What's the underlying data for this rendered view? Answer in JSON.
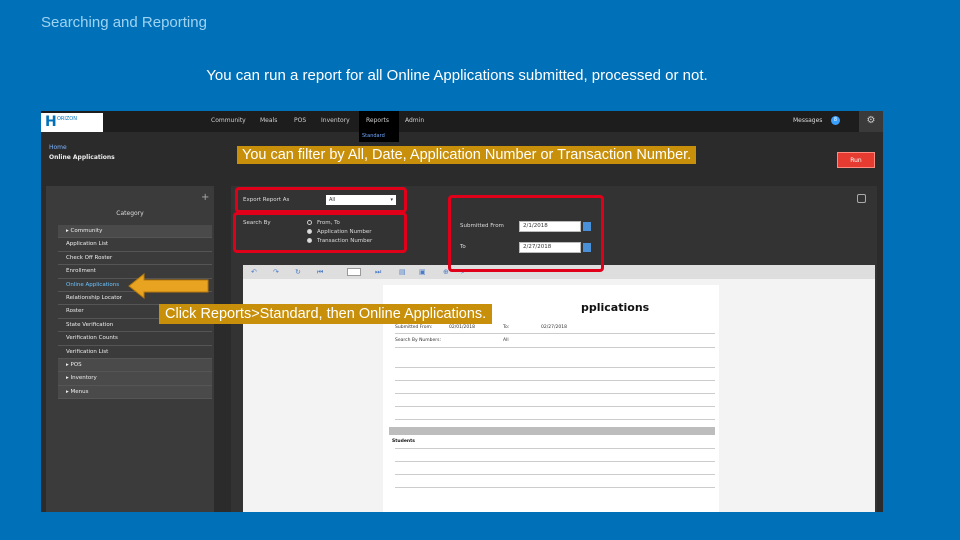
{
  "slide": {
    "title": "Searching and Reporting",
    "subtitle": "You can run a report for all Online Applications submitted, processed or not."
  },
  "callouts": {
    "filter": "You can filter by All, Date, Application Number or Transaction Number.",
    "click": "Click Reports>Standard, then Online Applications."
  },
  "app": {
    "logo_letter": "H",
    "logo_text": "ORIZON",
    "nav": [
      "Community",
      "Meals",
      "POS",
      "Inventory",
      "Reports",
      "Admin"
    ],
    "active_nav": "Reports",
    "submenu": "Standard",
    "user": "Messages",
    "user_badge": "8",
    "breadcrumb_home": "Home",
    "breadcrumb_page": "Online Applications",
    "run_label": "Run"
  },
  "sidebar": {
    "category_label": "Category",
    "items": [
      {
        "label": "Community",
        "style": "bar"
      },
      {
        "label": "Application List",
        "style": ""
      },
      {
        "label": "Check Off Roster",
        "style": ""
      },
      {
        "label": "Enrollment",
        "style": ""
      },
      {
        "label": "Online Applications",
        "style": "hl"
      },
      {
        "label": "Relationship Locator",
        "style": ""
      },
      {
        "label": "Roster",
        "style": ""
      },
      {
        "label": "State Verification",
        "style": ""
      },
      {
        "label": "Verification Counts",
        "style": ""
      },
      {
        "label": "Verification List",
        "style": ""
      },
      {
        "label": "POS",
        "style": "bar"
      },
      {
        "label": "Inventory",
        "style": "bar"
      },
      {
        "label": "Menus",
        "style": "bar"
      }
    ]
  },
  "filters": {
    "export_label": "Export Report As",
    "export_value": "All",
    "search_by_label": "Search By",
    "options": [
      "From, To",
      "Application Number",
      "Transaction Number"
    ],
    "submitted_from_label": "Submitted From",
    "submitted_from_value": "2/1/2018",
    "to_label": "To",
    "to_value": "2/27/2018"
  },
  "report": {
    "heading": "pplications",
    "rows": [
      [
        "Submitted From:",
        "02/01/2018",
        "To:",
        "02/27/2018"
      ],
      [
        "Search By Numbers:",
        "",
        "All",
        ""
      ]
    ],
    "section_students": "Students"
  }
}
